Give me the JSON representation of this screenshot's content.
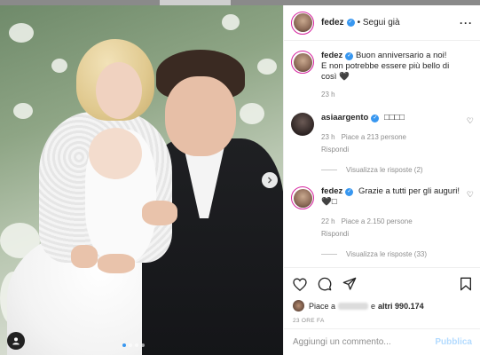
{
  "post": {
    "username": "fedez",
    "follow_label": "• Segui già",
    "more_icon": "more-dots-icon"
  },
  "caption": {
    "username": "fedez",
    "text_line1": "Buon anniversario a noi!",
    "text_line2": "E non potrebbe essere più bello di",
    "text_line3": "così 🖤",
    "time": "23 h"
  },
  "comments": [
    {
      "username": "asiaargento",
      "text": "□□□□",
      "time": "23 h",
      "likes": "Piace a 213 persone",
      "reply": "Rispondi",
      "view_replies": "Visualizza le risposte (2)"
    },
    {
      "username": "fedez",
      "text": "Grazie a tutti per gli auguri! 🖤□",
      "time": "22 h",
      "likes": "Piace a 2.150 persone",
      "reply": "Rispondi",
      "view_replies": "Visualizza le risposte (33)"
    }
  ],
  "likes": {
    "prefix": "Piace a",
    "suffix": "e",
    "count": "altri 990.174"
  },
  "date": "23 ORE FA",
  "add_comment": {
    "placeholder": "Aggiungi un commento...",
    "publish": "Pubblica"
  },
  "colors": {
    "accent": "#3897f0",
    "publish_disabled": "#b3dbff"
  }
}
